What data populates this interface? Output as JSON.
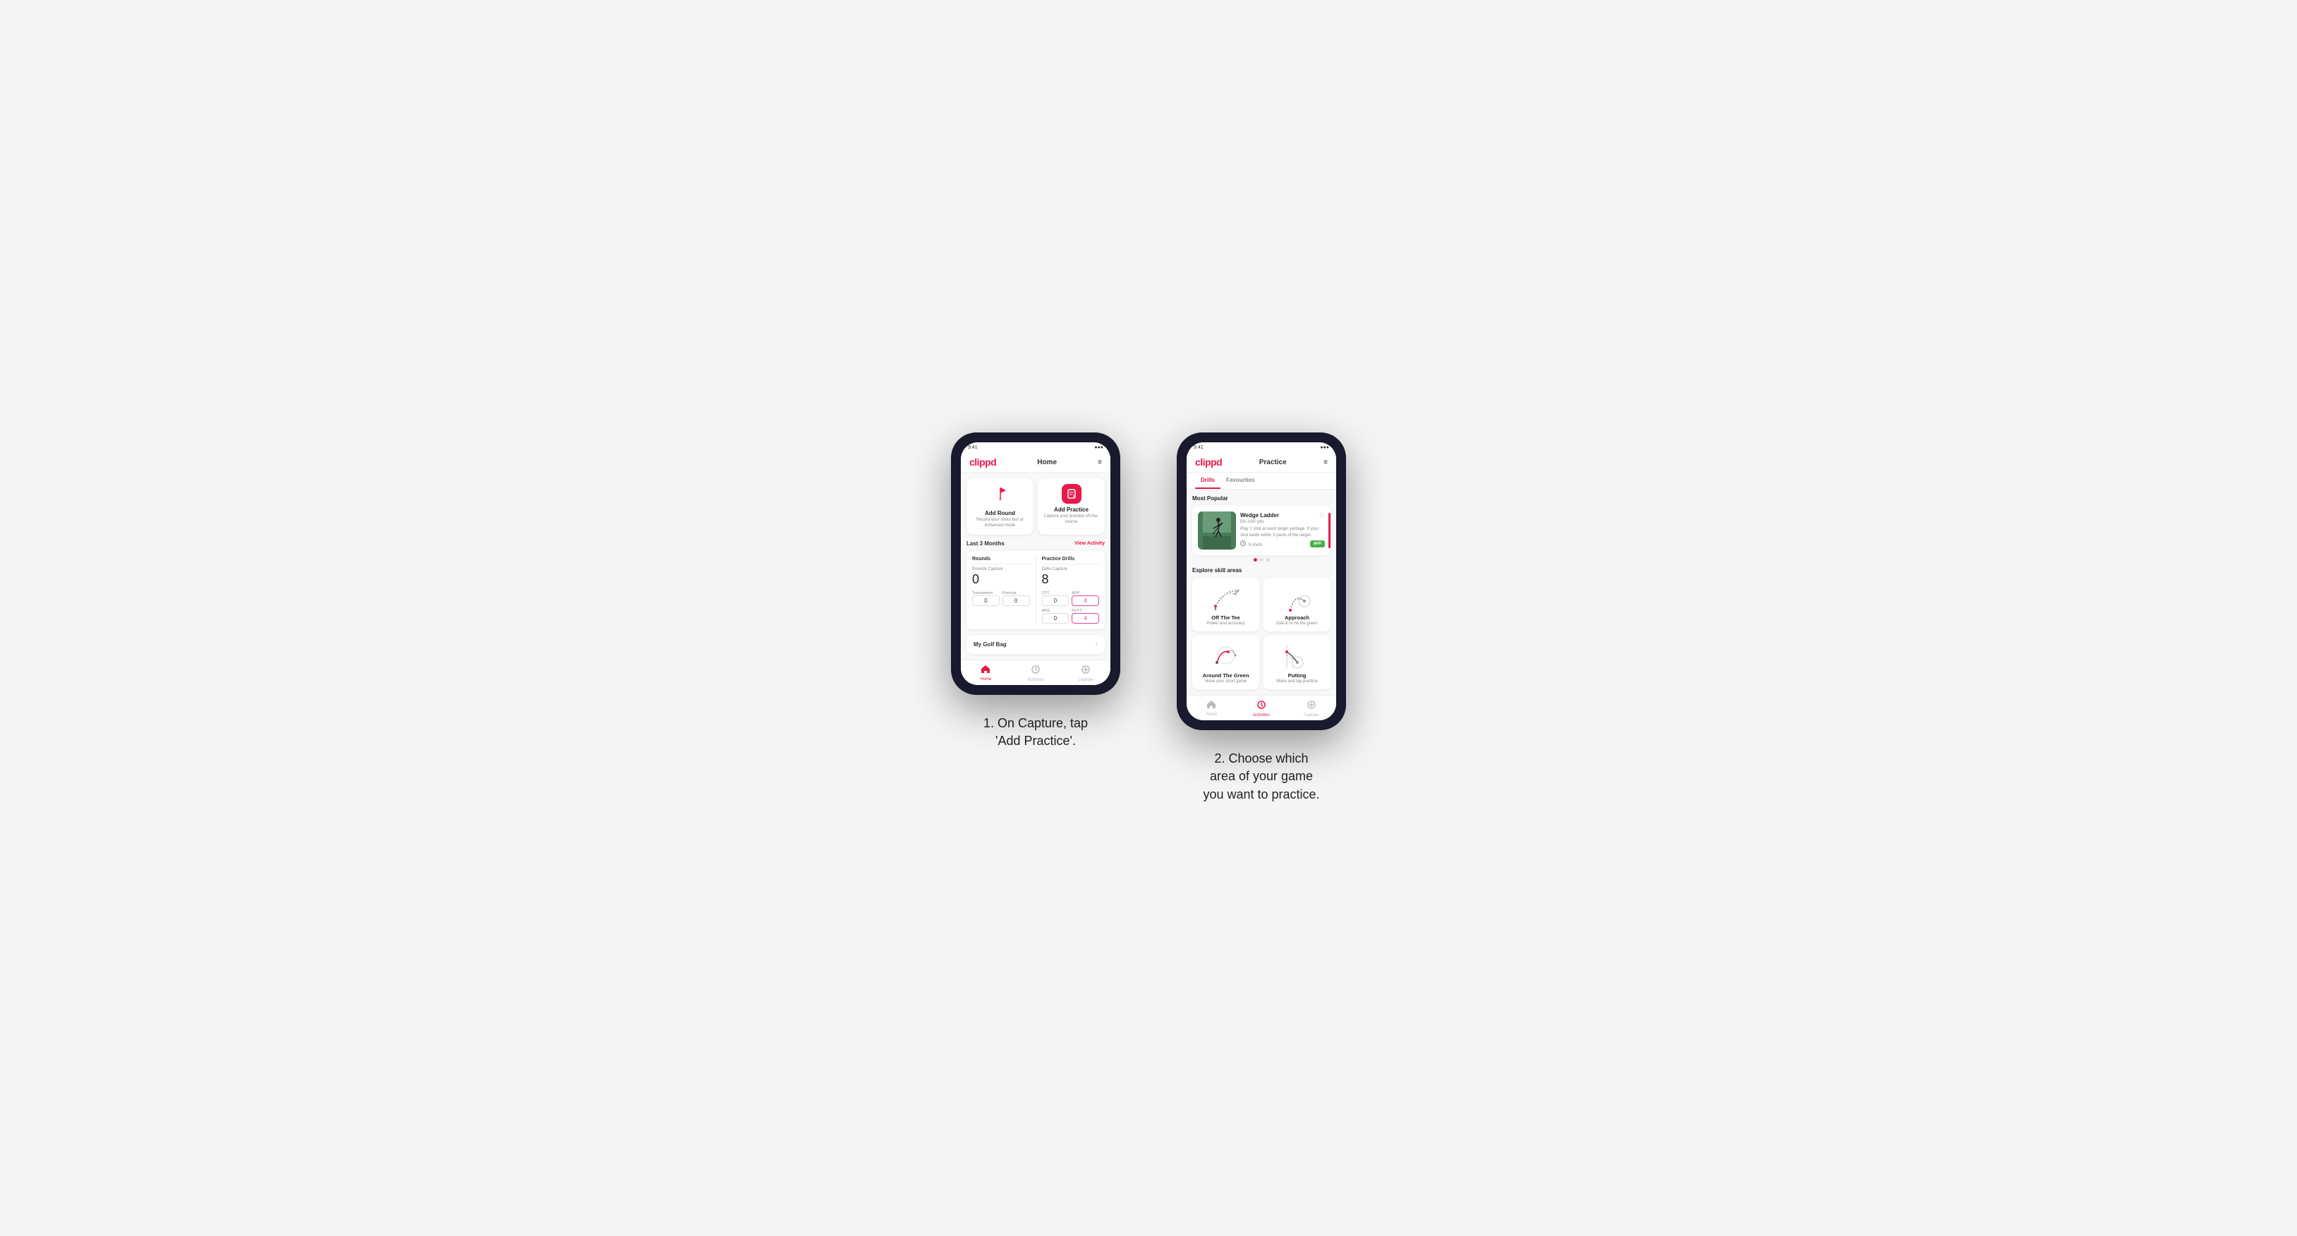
{
  "phone1": {
    "header": {
      "logo": "clippd",
      "title": "Home",
      "menu_icon": "≡"
    },
    "action_cards": [
      {
        "id": "add-round",
        "icon": "⛳",
        "title": "Add Round",
        "subtitle": "Record your shots fast or enhanced mode"
      },
      {
        "id": "add-practice",
        "icon": "📋",
        "title": "Add Practice",
        "subtitle": "Capture your practice off-the-course"
      }
    ],
    "last_months": {
      "label": "Last 3 Months",
      "link": "View Activity"
    },
    "rounds": {
      "title": "Rounds",
      "rounds_capture_label": "Rounds Capture",
      "rounds_capture_value": "0",
      "tournament_label": "Tournament",
      "tournament_value": "0",
      "practice_label": "Practice",
      "practice_value": "0"
    },
    "practice_drills": {
      "title": "Practice Drills",
      "drills_capture_label": "Drills Capture",
      "drills_capture_value": "8",
      "ott_label": "OTT",
      "ott_value": "0",
      "app_label": "APP",
      "app_value": "4",
      "arg_label": "ARG",
      "arg_value": "0",
      "putt_label": "PUTT",
      "putt_value": "4"
    },
    "golf_bag": {
      "label": "My Golf Bag"
    },
    "nav": [
      {
        "id": "home",
        "icon": "⌂",
        "label": "Home",
        "active": true
      },
      {
        "id": "activities",
        "icon": "⊕",
        "label": "Activities",
        "active": false
      },
      {
        "id": "capture",
        "icon": "⊕",
        "label": "Capture",
        "active": false
      }
    ]
  },
  "phone2": {
    "header": {
      "logo": "clippd",
      "title": "Practice",
      "menu_icon": "≡"
    },
    "tabs": [
      {
        "id": "drills",
        "label": "Drills",
        "active": true
      },
      {
        "id": "favourites",
        "label": "Favourites",
        "active": false
      }
    ],
    "most_popular": {
      "section_title": "Most Popular",
      "card": {
        "title": "Wedge Ladder",
        "yards": "50–100 yds",
        "description": "Play 1 shot at each target yardage. If your shot lands within 3 yards of the target..",
        "shots": "9 shots",
        "badge": "APP"
      },
      "dots": [
        true,
        false,
        false
      ]
    },
    "explore": {
      "section_title": "Explore skill areas",
      "skills": [
        {
          "id": "off-the-tee",
          "name": "Off The Tee",
          "subtitle": "Power and accuracy",
          "color": "#555"
        },
        {
          "id": "approach",
          "name": "Approach",
          "subtitle": "Dial-in to hit the green",
          "color": "#555"
        },
        {
          "id": "around-the-green",
          "name": "Around The Green",
          "subtitle": "Hone your short game",
          "color": "#555"
        },
        {
          "id": "putting",
          "name": "Putting",
          "subtitle": "Make and lag practice",
          "color": "#555"
        }
      ]
    },
    "nav": [
      {
        "id": "home",
        "icon": "⌂",
        "label": "Home",
        "active": false
      },
      {
        "id": "activities",
        "icon": "⊕",
        "label": "Activities",
        "active": true
      },
      {
        "id": "capture",
        "icon": "⊕",
        "label": "Capture",
        "active": false
      }
    ]
  },
  "captions": [
    "1. On Capture, tap\n'Add Practice'.",
    "2. Choose which\narea of your game\nyou want to practice."
  ],
  "colors": {
    "brand_red": "#e8194b",
    "active_purple": "#d946a8",
    "green_badge": "#4caf50"
  }
}
